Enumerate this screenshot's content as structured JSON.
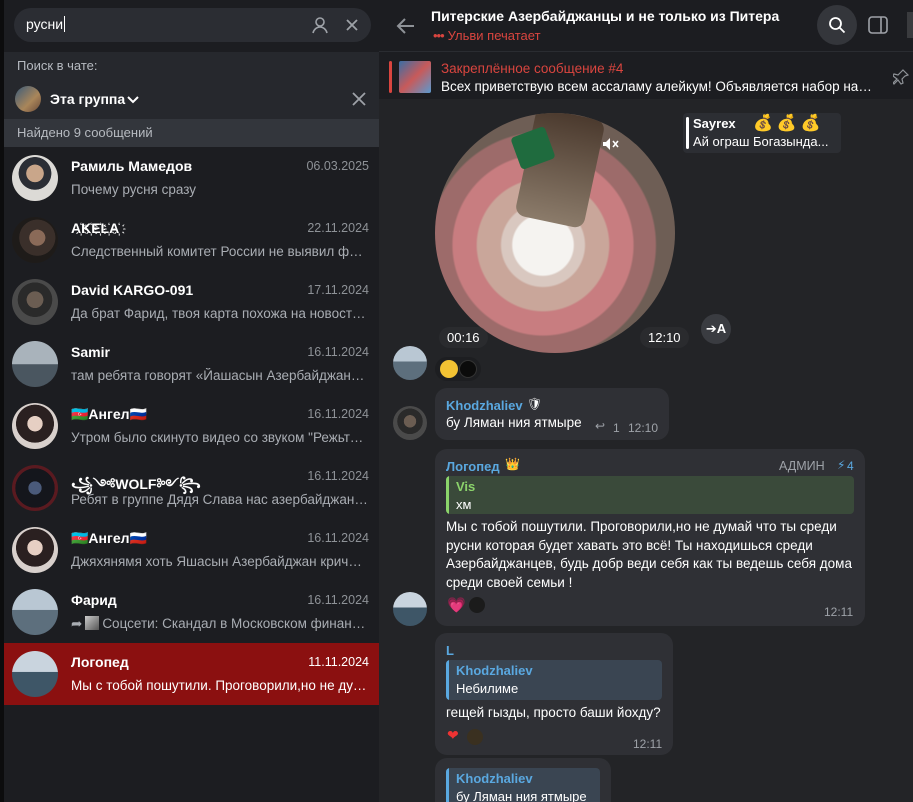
{
  "colors": {
    "accent_red": "#d9453f",
    "active_row": "#8b1010",
    "link_blue": "#5aa8e0",
    "green_name": "#8bd36b"
  },
  "search": {
    "query": "русни"
  },
  "sidebar": {
    "search_in_chat_label": "Поиск в чате:",
    "group_label": "Эта группа",
    "found_label": "Найдено 9 сообщений",
    "results": [
      {
        "name": "Рамиль Мамедов",
        "date": "06.03.2025",
        "text": "Почему русня сразу"
      },
      {
        "name": "A҉K҉E҉L҉A҉",
        "date": "22.11.2024",
        "text": "Следственный комитет России не выявил факты"
      },
      {
        "name": "David KARGO-091",
        "date": "17.11.2024",
        "text": "Да брат Фарид, твоя карта похожа на новости, ..."
      },
      {
        "name": "Samir",
        "date": "16.11.2024",
        "text": "там ребята говорят «Йашасын Азербайджан», ..."
      },
      {
        "name": "🇦🇿Ангел🇷🇺",
        "date": "16.11.2024",
        "text": "Утром было скинуто видео со звуком \"Режьте русню\""
      },
      {
        "name": "꧁༺WOLF༻꧂",
        "date": "16.11.2024",
        "text": "Ребят в группе Дядя Слава нас азербайджанцев"
      },
      {
        "name": "🇦🇿Ангел🇷🇺",
        "date": "16.11.2024",
        "text": "Джяхянямя хоть Яшасын Азербайджан кричали"
      },
      {
        "name": "Фарид",
        "date": "16.11.2024",
        "text": "Соцсети: Скандал в Московском финансовом"
      },
      {
        "name": "Логопед",
        "date": "11.11.2024",
        "text": "Мы с тобой пошутили. Проговорили,но не думай"
      }
    ]
  },
  "header": {
    "title": "Питерские Азербайджанцы и не только из Питера",
    "typing": "Ульви печатает"
  },
  "pinned": {
    "title": "Закреплённое сообщение #4",
    "text": "Всех приветствую всем ассаламу алейкум!  Объявляется набор на страницу"
  },
  "messages": {
    "video": {
      "duration": "00:16",
      "time": "12:10",
      "translate": "➔A"
    },
    "reply_float": {
      "name": "Sayrex",
      "text": "Ай ограш  Богазында..."
    },
    "msg1": {
      "name": "Khodzhaliev",
      "text": "бу Ляман ния ятмыре",
      "replies": "1",
      "time": "12:10"
    },
    "msg2": {
      "name": "Логопед",
      "role": "АДМИН",
      "boost": "4",
      "quote_name": "Vis",
      "quote_text": "хм",
      "text": "Мы с тобой пошутили. Проговорили,но не думай что ты среди русни которая будет хавать это всё! Ты находишься среди Азербайджанцев, будь добр веди себя как ты ведешь себя дома среди своей семьи !",
      "time": "12:11"
    },
    "msg3": {
      "name": "L",
      "quote_name": "Khodzhaliev",
      "quote_text": "Небилиме",
      "text": "гещей гызды, просто баши йохду?",
      "time": "12:11"
    },
    "msg4": {
      "quote_name": "Khodzhaliev",
      "quote_text": "бу Ляман ния ятмыре"
    }
  }
}
